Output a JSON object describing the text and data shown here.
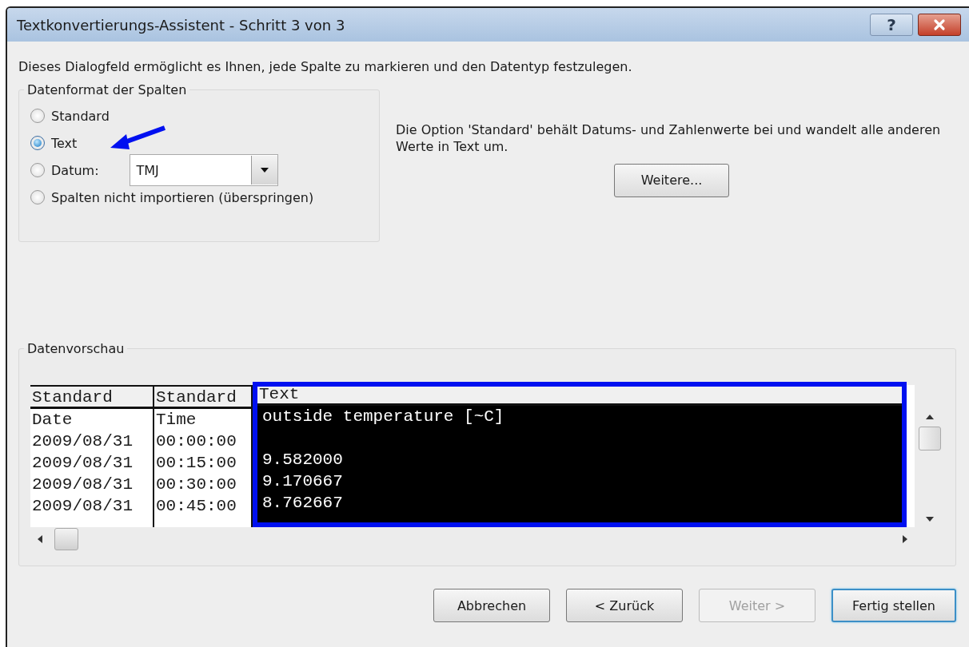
{
  "window": {
    "title": "Textkonvertierungs-Assistent - Schritt 3 von 3",
    "help_label": "?"
  },
  "intro": "Dieses Dialogfeld ermöglicht es Ihnen, jede Spalte zu markieren und den Datentyp festzulegen.",
  "format_group": {
    "title": "Datenformat der Spalten",
    "options": [
      {
        "label": "Standard",
        "selected": false,
        "kind": "plain"
      },
      {
        "label": "Text",
        "selected": true,
        "kind": "plain"
      },
      {
        "label": "Datum:",
        "selected": false,
        "kind": "date",
        "dropdown_value": "TMJ"
      },
      {
        "label": "Spalten nicht importieren (überspringen)",
        "selected": false,
        "kind": "plain"
      }
    ]
  },
  "description": "Die Option 'Standard' behält Datums- und Zahlenwerte bei und wandelt alle anderen Werte in Text um.",
  "more_button": "Weitere...",
  "preview": {
    "title": "Datenvorschau",
    "columns": [
      {
        "header": "Standard",
        "selected": false
      },
      {
        "header": "Standard",
        "selected": false
      },
      {
        "header": "Text",
        "selected": true
      }
    ],
    "rows": [
      {
        "cells": [
          "Date",
          "Time",
          "outside temperature [~C]"
        ]
      },
      {
        "cells": [
          "2009/08/31",
          "00:00:00"
        ]
      },
      {
        "cells": [
          "2009/08/31",
          "00:15:00",
          "9.582000"
        ]
      },
      {
        "cells": [
          "2009/08/31",
          "00:30:00",
          "9.170667"
        ]
      },
      {
        "cells": [
          "2009/08/31",
          "00:45:00",
          "8.762667"
        ]
      }
    ]
  },
  "buttons": [
    {
      "label": "Abbrechen",
      "disabled": false,
      "default": false
    },
    {
      "label": "< Zurück",
      "disabled": false,
      "default": false
    },
    {
      "label": "Weiter >",
      "disabled": true,
      "default": false
    },
    {
      "label": "Fertig stellen",
      "disabled": false,
      "default": true
    }
  ]
}
